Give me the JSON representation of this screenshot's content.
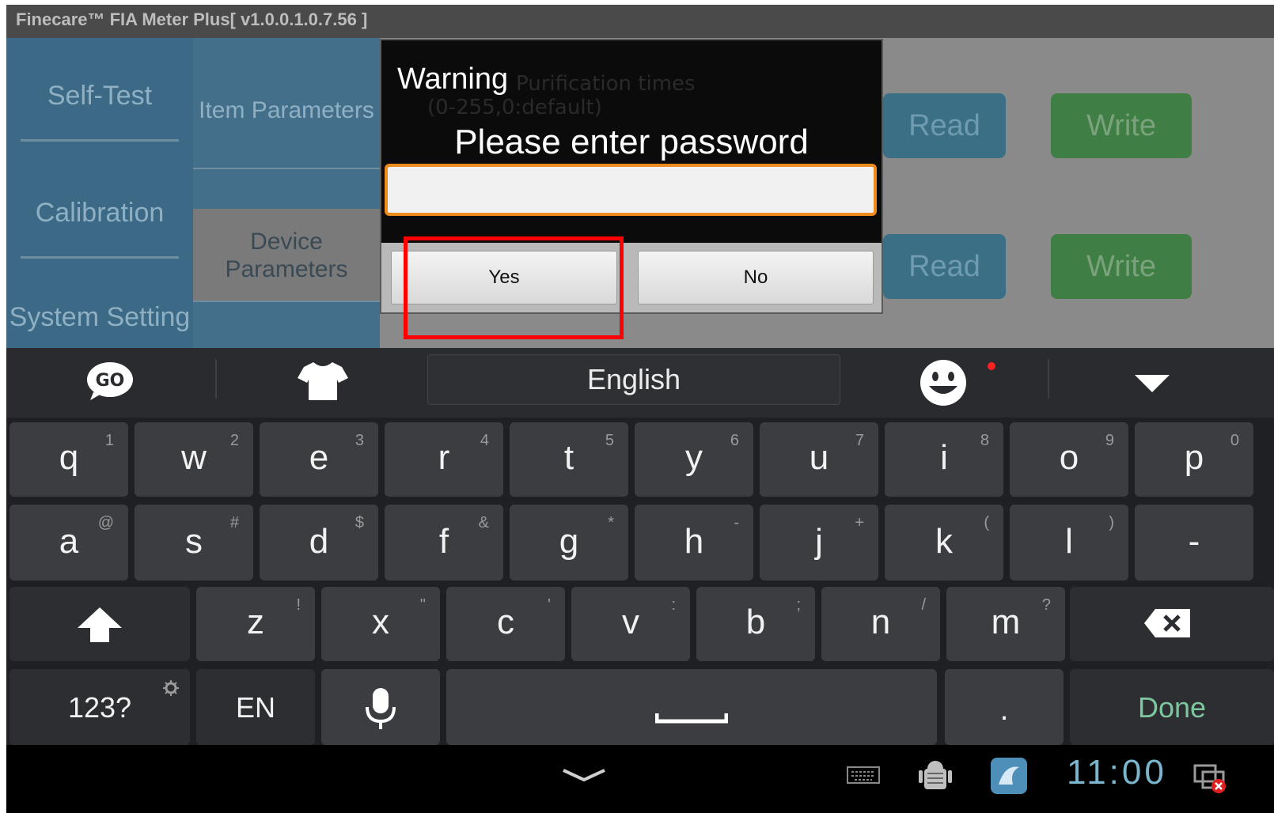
{
  "title_bar": {
    "title": "Finecare™ FIA Meter Plus[ v1.0.0.1.0.7.56 ]"
  },
  "left_nav": {
    "items": [
      "Self-Test",
      "Calibration",
      "System Setting"
    ]
  },
  "sub_nav": {
    "items": [
      "Item Parameters",
      "Device Parameters"
    ]
  },
  "background_content": {
    "ghost_line1": "Purification times",
    "ghost_line2": "(0-255,0:default)",
    "read_label": "Read",
    "write_label": "Write"
  },
  "dialog": {
    "title": "Warning",
    "message": "Please enter password",
    "password_value": "",
    "yes_label": "Yes",
    "no_label": "No"
  },
  "keyboard": {
    "language": "English",
    "row1": [
      {
        "k": "q",
        "s": "1"
      },
      {
        "k": "w",
        "s": "2"
      },
      {
        "k": "e",
        "s": "3"
      },
      {
        "k": "r",
        "s": "4"
      },
      {
        "k": "t",
        "s": "5"
      },
      {
        "k": "y",
        "s": "6"
      },
      {
        "k": "u",
        "s": "7"
      },
      {
        "k": "i",
        "s": "8"
      },
      {
        "k": "o",
        "s": "9"
      },
      {
        "k": "p",
        "s": "0"
      }
    ],
    "row2": [
      {
        "k": "a",
        "s": "@"
      },
      {
        "k": "s",
        "s": "#"
      },
      {
        "k": "d",
        "s": "$"
      },
      {
        "k": "f",
        "s": "&"
      },
      {
        "k": "g",
        "s": "*"
      },
      {
        "k": "h",
        "s": "-"
      },
      {
        "k": "j",
        "s": "+"
      },
      {
        "k": "k",
        "s": "("
      },
      {
        "k": "l",
        "s": ")"
      },
      {
        "k": "-",
        "s": ""
      }
    ],
    "row3": [
      {
        "k": "z",
        "s": "!"
      },
      {
        "k": "x",
        "s": "\""
      },
      {
        "k": "c",
        "s": "'"
      },
      {
        "k": "v",
        "s": ":"
      },
      {
        "k": "b",
        "s": ";"
      },
      {
        "k": "n",
        "s": "/"
      },
      {
        "k": "m",
        "s": "?"
      }
    ],
    "symbols_label": "123?",
    "lang_key_label": "EN",
    "period_label": ".",
    "done_label": "Done"
  },
  "status_bar": {
    "time": "11:00"
  },
  "icons": [
    "go-icon",
    "shirt-icon",
    "emoji-icon",
    "collapse-icon",
    "shift-icon",
    "backspace-icon",
    "settings-icon",
    "mic-icon",
    "space-icon",
    "nav-back-chevron-icon",
    "keyboard-icon",
    "android-debug-icon",
    "app-icon",
    "network-error-icon"
  ],
  "colors": {
    "accent_focus": "#f08a1c",
    "highlight": "#ff0000",
    "done_text": "#7cc7a0",
    "clock": "#7ab7ce"
  }
}
